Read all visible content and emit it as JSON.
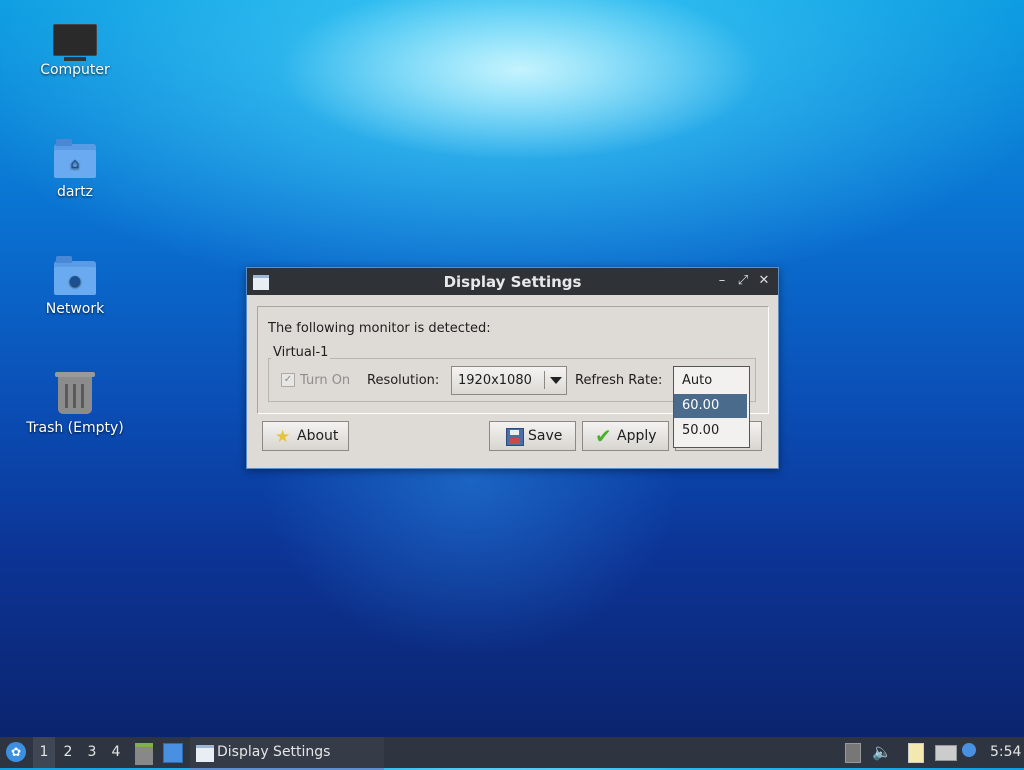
{
  "desktop": {
    "icons": [
      {
        "label": "Computer",
        "icon": "computer-icon"
      },
      {
        "label": "dartz",
        "icon": "home-folder-icon"
      },
      {
        "label": "Network",
        "icon": "network-folder-icon"
      },
      {
        "label": "Trash (Empty)",
        "icon": "trash-icon"
      }
    ]
  },
  "window": {
    "title": "Display Settings",
    "detected_text": "The following monitor is detected:",
    "monitor_name": "Virtual-1",
    "turn_on_label": "Turn On",
    "turn_on_checked": true,
    "resolution_label": "Resolution:",
    "resolution_value": "1920x1080",
    "refresh_label": "Refresh Rate:",
    "refresh_options": [
      "Auto",
      "60.00",
      "50.00"
    ],
    "refresh_selected": "60.00",
    "buttons": {
      "about": "About",
      "save": "Save",
      "apply": "Apply"
    }
  },
  "taskbar": {
    "workspaces": [
      "1",
      "2",
      "3",
      "4"
    ],
    "active_workspace": "1",
    "task_label": "Display Settings",
    "clock": "5:54"
  },
  "colors": {
    "titlebar": "#2f3236",
    "taskbar": "#2e3440",
    "selection": "#4a6b8c",
    "window_bg": "#dedbd6"
  }
}
